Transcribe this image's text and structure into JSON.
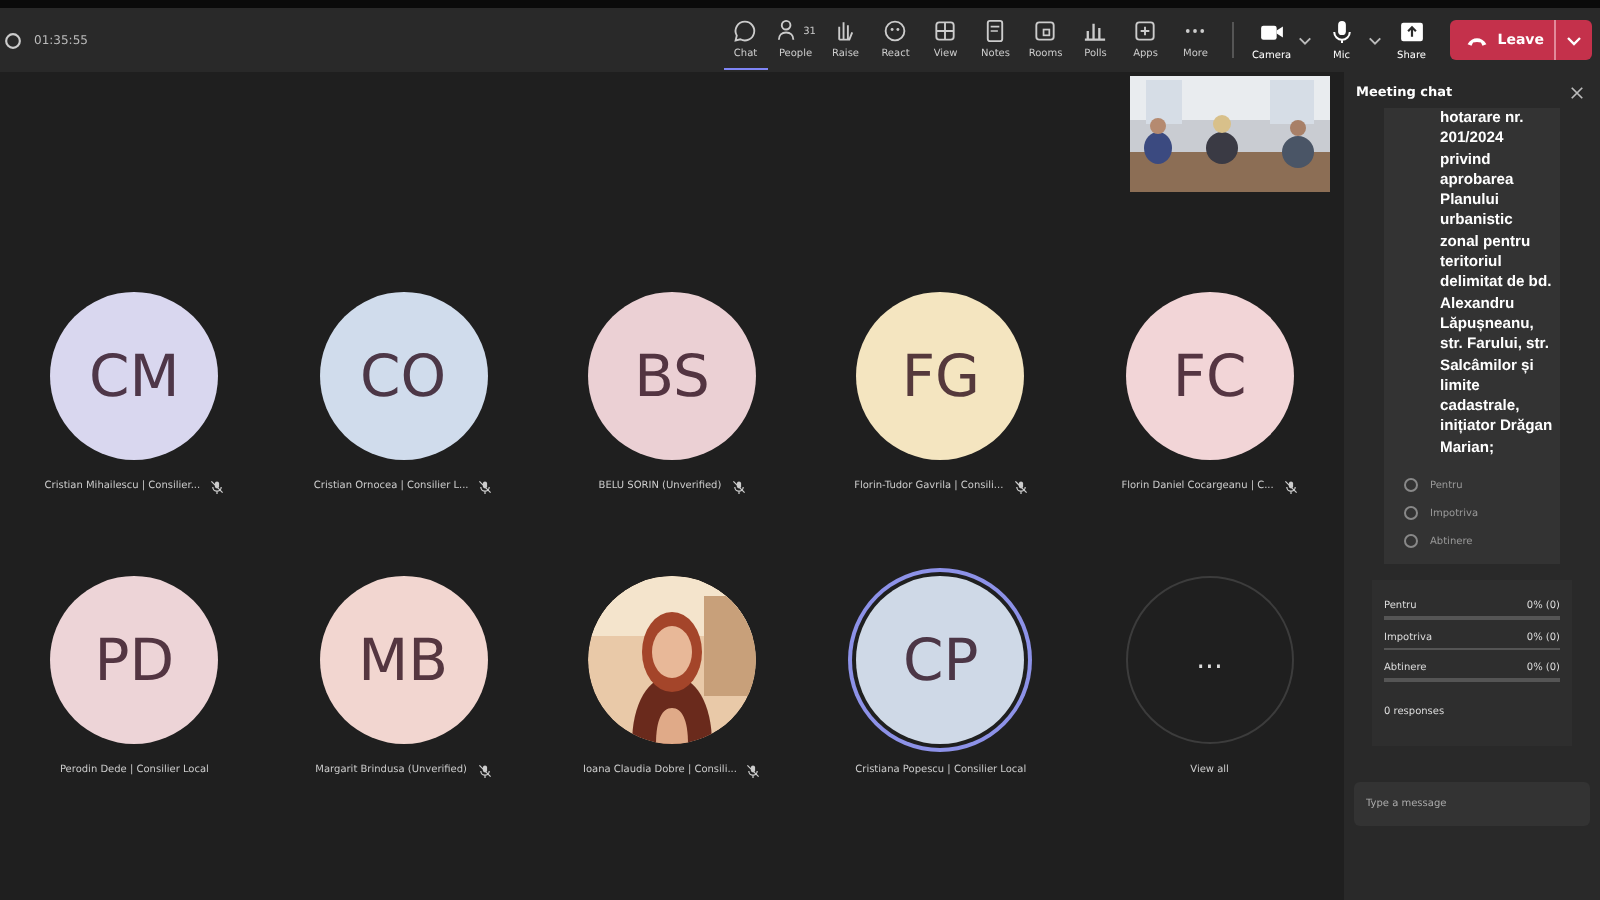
{
  "toolbar": {
    "timer": "01:35:55",
    "items": [
      {
        "kind": "chat",
        "label": "Chat",
        "selected": true
      },
      {
        "kind": "people",
        "label": "People",
        "count": "31",
        "selected": false
      },
      {
        "kind": "raise",
        "label": "Raise",
        "selected": false
      },
      {
        "kind": "react",
        "label": "React",
        "selected": false
      },
      {
        "kind": "view",
        "label": "View",
        "selected": false
      },
      {
        "kind": "notes",
        "label": "Notes",
        "selected": false
      },
      {
        "kind": "rooms",
        "label": "Rooms",
        "selected": false
      },
      {
        "kind": "polls",
        "label": "Polls",
        "selected": false
      },
      {
        "kind": "apps",
        "label": "Apps",
        "selected": false
      },
      {
        "kind": "more",
        "label": "More",
        "selected": false
      }
    ],
    "devices": [
      {
        "kind": "camera",
        "label": "Camera",
        "caret": true
      },
      {
        "kind": "mic",
        "label": "Mic",
        "caret": true
      },
      {
        "kind": "share",
        "label": "Share",
        "caret": false
      }
    ],
    "leave": "Leave"
  },
  "participants": [
    {
      "kind": "avatar",
      "initials": "CM",
      "name": "Cristian Mihailescu | Consilier...",
      "muted": true,
      "speaking": false,
      "color": "#d9d7ef"
    },
    {
      "kind": "avatar",
      "initials": "CO",
      "name": "Cristian Ornocea | Consilier L...",
      "muted": true,
      "speaking": false,
      "color": "#d0dcec"
    },
    {
      "kind": "avatar",
      "initials": "BS",
      "name": "BELU SORIN (Unverified)",
      "muted": true,
      "speaking": false,
      "color": "#ebd0d4"
    },
    {
      "kind": "avatar",
      "initials": "FG",
      "name": "Florin-Tudor Gavrila | Consili...",
      "muted": true,
      "speaking": false,
      "color": "#f4e5c0"
    },
    {
      "kind": "avatar",
      "initials": "FC",
      "name": "Florin Daniel Cocargeanu | C...",
      "muted": true,
      "speaking": false,
      "color": "#f2d5d7"
    },
    {
      "kind": "avatar",
      "initials": "PD",
      "name": "Perodin Dede | Consilier Local",
      "muted": false,
      "speaking": false,
      "color": "#edd4d7"
    },
    {
      "kind": "avatar",
      "initials": "MB",
      "name": "Margarit Brindusa (Unverified)",
      "muted": true,
      "speaking": false,
      "color": "#f2d6d0"
    },
    {
      "kind": "picture",
      "name": "Ioana Claudia Dobre | Consili...",
      "muted": true,
      "speaking": false
    },
    {
      "kind": "avatar",
      "initials": "CP",
      "name": "Cristiana Popescu | Consilier Local",
      "muted": false,
      "speaking": true,
      "color": "#cfd9e7"
    },
    {
      "kind": "more",
      "initials": "...",
      "name": "View all",
      "muted": false,
      "speaking": false
    }
  ],
  "chat": {
    "title": "Meeting chat",
    "message": "hotarare nr. 201/2024 privind aprobarea Planului urbanistic zonal pentru teritoriul delimitat de bd. Alexandru Lăpușneanu, str. Farului, str. Salcâmilor și limite cadastrale, inițiator Drăgan Marian;",
    "options": [
      {
        "label": "Pentru",
        "selected": false
      },
      {
        "label": "Impotriva",
        "selected": false
      },
      {
        "label": "Abtinere",
        "selected": false
      }
    ],
    "results": [
      {
        "label": "Pentru",
        "reading": "0% (0)",
        "level": 0
      },
      {
        "label": "Impotriva",
        "reading": "0% (0)",
        "level": 0
      },
      {
        "label": "Abtinere",
        "reading": "0% (0)",
        "level": 0
      }
    ],
    "responses": "0 responses",
    "compose": {
      "placeholder": "Type a message"
    }
  }
}
